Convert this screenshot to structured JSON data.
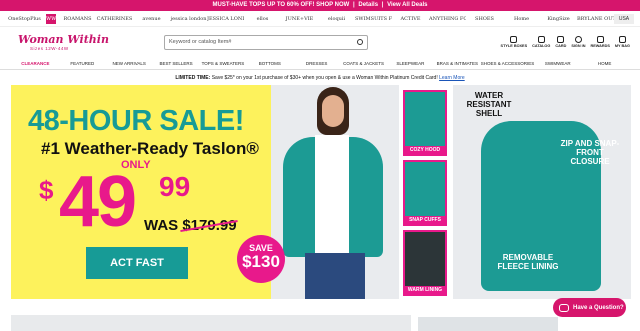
{
  "topbar": {
    "text": "MUST-HAVE TOPS UP TO 60% OFF! SHOP NOW",
    "sep": "|",
    "details": "Details",
    "view_all": "View All Deals"
  },
  "brands": [
    "OneStopPlus",
    "ww",
    "ROAMANS",
    "CATHERINES",
    "avenue",
    "jessica london",
    "JESSICA LONDON",
    "ellos",
    "JUNE+VIE",
    "eloquii",
    "SWIMSUITS FOR ALL",
    "ACTIVE",
    "ANYTHING FOR",
    "SHOES",
    "Home",
    "KingSize",
    "BRYLANE OUTLET",
    "USA"
  ],
  "header": {
    "logo": "Woman Within",
    "logo_sub": "Sizes 12W-44W",
    "search_placeholder": "Keyword or catalog Item#",
    "icons": [
      {
        "name": "style-boxes",
        "label": "STYLE BOXES"
      },
      {
        "name": "catalog",
        "label": "CATALOG"
      },
      {
        "name": "card",
        "label": "CARD"
      },
      {
        "name": "sign-in",
        "label": "SIGN IN"
      },
      {
        "name": "rewards",
        "label": "REWARDS"
      },
      {
        "name": "my-bag",
        "label": "MY BAG"
      }
    ]
  },
  "nav": [
    "CLEARANCE",
    "FEATURED",
    "NEW ARRIVALS",
    "BEST SELLERS",
    "TOPS & SWEATERS",
    "BOTTOMS",
    "DRESSES",
    "COATS & JACKETS",
    "SLEEPWEAR",
    "BRAS & INTIMATES",
    "SHOES & ACCESSORIES",
    "SWIMWEAR",
    "HOME"
  ],
  "promo": {
    "bold": "LIMITED TIME:",
    "text": " Save $25* on your 1st purchase of $30+ when you open & use a Woman Within Platinum Credit Card!",
    "link": "Learn More"
  },
  "hero": {
    "headline": "48-HOUR SALE!",
    "subhead": "#1 Weather-Ready Taslon®",
    "only": "ONLY",
    "price_dollar": "$",
    "price_main": "49",
    "price_cents": "99",
    "was_label": "WAS",
    "was_price": "$179.99",
    "cta": "ACT FAST",
    "save_label": "SAVE",
    "save_amount": "$130",
    "thumbs": [
      "COZY HOOD",
      "SNAP CUFFS",
      "WARM LINING"
    ],
    "feature_water": "WATER RESISTANT SHELL",
    "feature_zip": "ZIP AND SNAP-FRONT CLOSURE",
    "feature_fleece": "REMOVABLE FLEECE LINING"
  },
  "chat": {
    "label": "Have a Question?"
  }
}
